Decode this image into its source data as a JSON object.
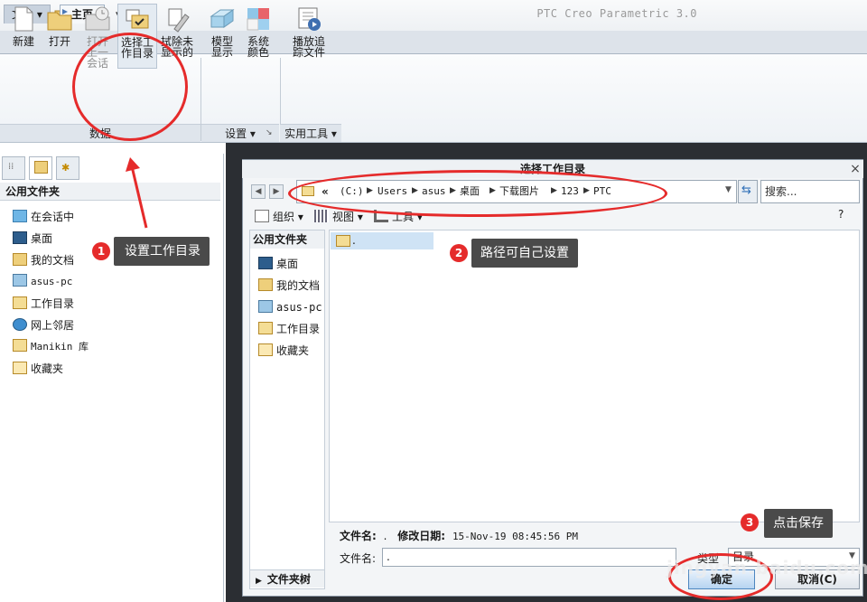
{
  "app": {
    "title": "PTC Creo Parametric 3.0"
  },
  "ribbon": {
    "tabs": [
      {
        "label": "文件 ▾"
      },
      {
        "label": "主页"
      }
    ],
    "buttons": [
      {
        "label": "新建"
      },
      {
        "label": "打开"
      },
      {
        "label": "打开上一会话"
      },
      {
        "label": "选择工作目录"
      },
      {
        "label": "拭除未显示的"
      },
      {
        "label": "模型显示"
      },
      {
        "label": "系统颜色"
      },
      {
        "label": "播放追踪文件"
      }
    ],
    "groups": [
      {
        "label": "数据"
      },
      {
        "label": "设置 ▾"
      },
      {
        "label": "实用工具 ▾"
      }
    ]
  },
  "navigator": {
    "header": "公用文件夹",
    "items": [
      {
        "label": "在会话中"
      },
      {
        "label": "桌面"
      },
      {
        "label": "我的文档"
      },
      {
        "label": "asus-pc"
      },
      {
        "label": "工作目录"
      },
      {
        "label": "网上邻居"
      },
      {
        "label": "Manikin 库"
      },
      {
        "label": "收藏夹"
      }
    ]
  },
  "dialog": {
    "title": "选择工作目录",
    "close": "×",
    "address": {
      "prefix": "«",
      "crumbs": [
        "(C:)",
        "Users",
        "asus",
        "桌面",
        "下载图片",
        "123",
        "PTC"
      ]
    },
    "search_placeholder": "搜索...",
    "toolbar": {
      "organize": "组织 ▾",
      "view": "视图 ▾",
      "tools": "工具 ▾",
      "help": "?"
    },
    "sidebar": {
      "header": "公用文件夹",
      "items": [
        {
          "label": "桌面"
        },
        {
          "label": "我的文档"
        },
        {
          "label": "asus-pc"
        },
        {
          "label": "工作目录"
        },
        {
          "label": "收藏夹"
        }
      ],
      "folder_tree": "文件夹树"
    },
    "files": [
      {
        "name": "."
      }
    ],
    "info": {
      "name_label": "文件名:",
      "name_value": ".",
      "date_label": "修改日期:",
      "date_value": "15-Nov-19 08:45:56 PM"
    },
    "filename": {
      "label": "文件名:",
      "value": "."
    },
    "type": {
      "label": "类型",
      "value": "目录"
    },
    "ok_label": "确定",
    "cancel_label": "取消(C)"
  },
  "annotations": [
    {
      "number": "1",
      "text": "设置工作目录"
    },
    {
      "number": "2",
      "text": "路径可自己设置"
    },
    {
      "number": "3",
      "text": "点击保存"
    }
  ],
  "watermark": "jingyan.baidu.com",
  "colors": {
    "annotation": "#e52b2b",
    "callout_bg": "#4a4a4a",
    "workspace_bg": "#2b2e33",
    "selection": "#cfe3f5"
  }
}
